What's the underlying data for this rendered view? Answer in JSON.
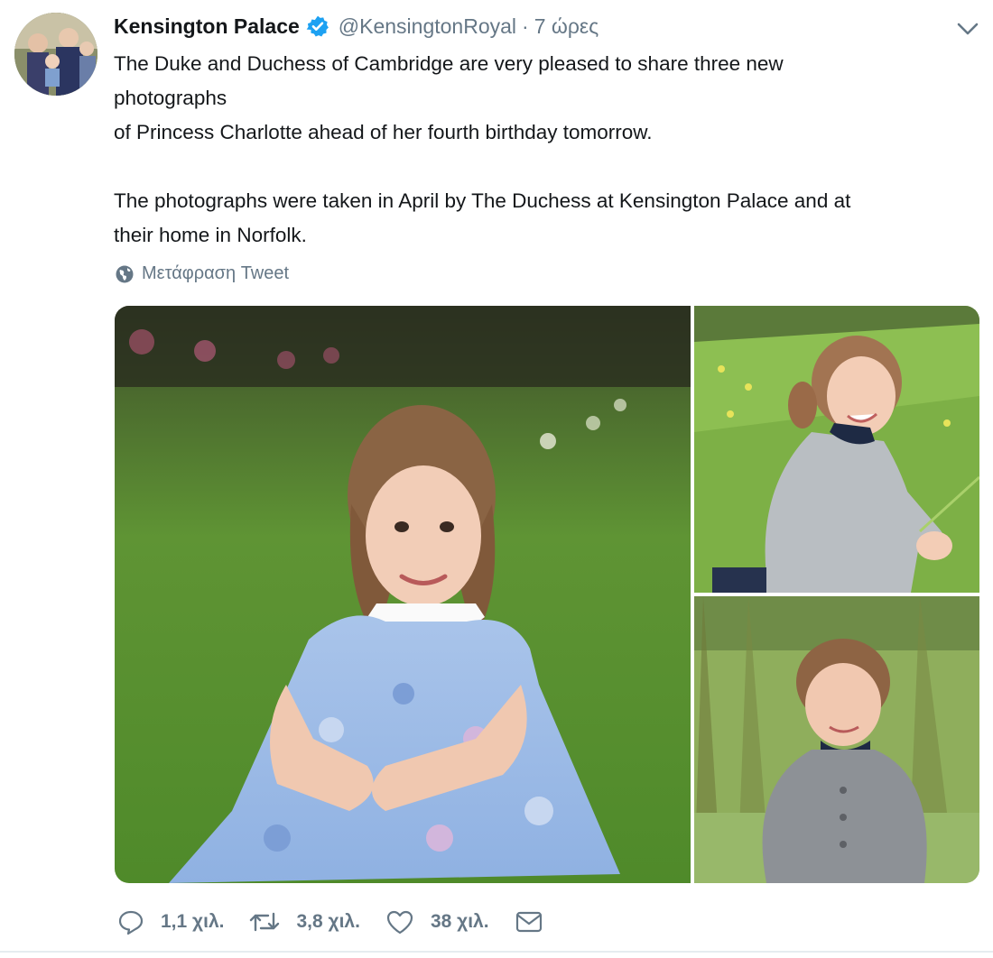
{
  "tweet": {
    "author_name": "Kensington Palace",
    "handle": "@KensingtonRoyal",
    "separator": "·",
    "time": "7 ώρες",
    "lines": [
      "The Duke and Duchess of Cambridge are very pleased to share three new",
      "photographs",
      "of Princess Charlotte ahead of her fourth birthday tomorrow.",
      "",
      "The photographs were taken in April by The Duchess at Kensington Palace and at",
      "their home in Norfolk."
    ],
    "translate_label": "Μετάφραση Tweet",
    "icons": {
      "avatar": "profile-avatar",
      "verified": "verified-badge-icon",
      "caret": "chevron-down-icon",
      "globe": "globe-icon",
      "reply": "reply-icon",
      "retweet": "retweet-icon",
      "like": "heart-icon",
      "dm": "envelope-icon"
    },
    "stats": {
      "replies": "1,1 χιλ.",
      "retweets": "3,8 χιλ.",
      "likes": "38 χιλ."
    },
    "colors": {
      "verified_blue": "#1da1f2",
      "secondary_text": "#657786",
      "primary_text": "#14171a"
    }
  }
}
